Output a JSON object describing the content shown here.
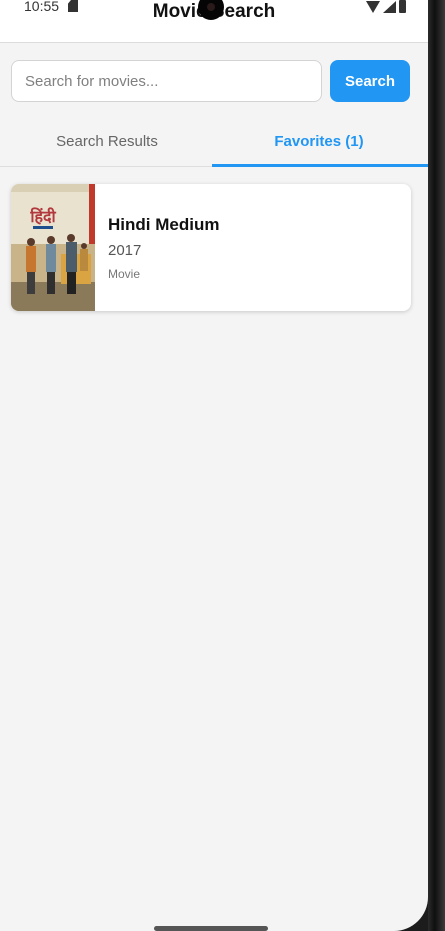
{
  "status_bar": {
    "time": "10:55",
    "icons": [
      "sd-card-icon",
      "wifi-icon",
      "signal-icon",
      "battery-icon"
    ]
  },
  "app": {
    "title": "Movie Search"
  },
  "search": {
    "placeholder": "Search for movies...",
    "value": "",
    "button_label": "Search"
  },
  "tabs": [
    {
      "label": "Search Results",
      "active": false
    },
    {
      "label": "Favorites (1)",
      "active": true
    }
  ],
  "favorites": [
    {
      "title": "Hindi Medium",
      "year": "2017",
      "type": "Movie",
      "poster_text": "हिंदी"
    }
  ],
  "colors": {
    "accent": "#2196f3",
    "background": "#f4f4f4",
    "card": "#ffffff"
  }
}
